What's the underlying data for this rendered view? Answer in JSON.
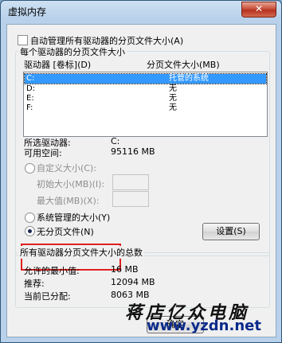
{
  "window": {
    "title": "虚拟内存",
    "close_glyph": "✕"
  },
  "auto_manage": {
    "label": "自动管理所有驱动器的分页文件大小(A)",
    "checked": false
  },
  "drive_group": {
    "title": "每个驱动器的分页文件大小",
    "col_drive": "驱动器 [卷标](D)",
    "col_size": "分页文件大小(MB)",
    "rows": [
      {
        "drive": "C:",
        "size": "托管的系统",
        "selected": true
      },
      {
        "drive": "D:",
        "size": "无",
        "selected": false
      },
      {
        "drive": "E:",
        "size": "无",
        "selected": false
      },
      {
        "drive": "F:",
        "size": "无",
        "selected": false
      }
    ]
  },
  "selected_drive": {
    "label": "所选驱动器:",
    "value": "C:"
  },
  "free_space": {
    "label": "可用空间:",
    "value": "95116 MB"
  },
  "custom_size": {
    "label": "自定义大小(C):",
    "initial_label": "初始大小(MB)(I):",
    "max_label": "最大值(MB)(X):"
  },
  "system_managed": {
    "label": "系统管理的大小(Y)"
  },
  "no_paging": {
    "label": "无分页文件(N)"
  },
  "set_button": {
    "label": "设置(S)"
  },
  "totals_group": {
    "title": "所有驱动器分页文件大小的总数",
    "min_label": "允许的最小值:",
    "min_value": "16 MB",
    "rec_label": "推荐:",
    "rec_value": "12094 MB",
    "cur_label": "当前已分配:",
    "cur_value": "8063 MB"
  },
  "ok_button": {
    "label": "确定"
  },
  "watermark": {
    "text": "蒋店亿众电脑",
    "url": "www.yzdn.net"
  },
  "colors": {
    "selection": "#3399ff",
    "highlight_box": "#e02020",
    "title_bar": "#b9d1ea"
  }
}
